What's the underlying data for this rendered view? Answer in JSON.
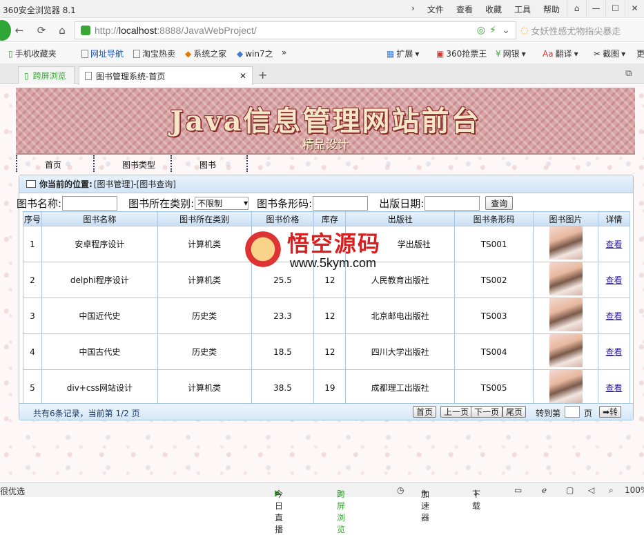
{
  "browser": {
    "title": "360安全浏览器 8.1",
    "menus": [
      "文件",
      "查看",
      "收藏",
      "工具",
      "帮助"
    ],
    "url_host": "http://",
    "url_domain": "localhost",
    "url_rest": ":8888/JavaWebProject/",
    "search_text": "女妖性感尤物指尖暴走",
    "bookmarks": [
      "手机收藏夹",
      "网址导航",
      "淘宝热卖",
      "系统之家",
      "win7之",
      "扩展",
      "360抢票王",
      "网银",
      "翻译",
      "截图",
      "更"
    ],
    "tabs": [
      "跨屏浏览",
      "图书管理系统-首页"
    ]
  },
  "banner": {
    "title": "Java信息管理网站前台",
    "subtitle": "精品设计"
  },
  "nav": [
    "首页",
    "图书类型",
    "图书"
  ],
  "breadcrumb": {
    "label": "你当前的位置:",
    "path": "[图书管理]-[图书查询]"
  },
  "search": {
    "name_label": "图书名称:",
    "category_label": "图书所在类别:",
    "category_value": "不限制",
    "barcode_label": "图书条形码:",
    "date_label": "出版日期:",
    "button": "查询"
  },
  "table": {
    "headers": [
      "序号",
      "图书名称",
      "图书所在类别",
      "图书价格",
      "库存",
      "出版社",
      "图书条形码",
      "图书图片",
      "详情"
    ],
    "rows": [
      {
        "no": "1",
        "name": "安卓程序设计",
        "category": "计算机类",
        "price": "",
        "stock": "",
        "publisher": "学出版社",
        "barcode": "TS001",
        "detail": "查看"
      },
      {
        "no": "2",
        "name": "delphi程序设计",
        "category": "计算机类",
        "price": "25.5",
        "stock": "12",
        "publisher": "人民教育出版社",
        "barcode": "TS002",
        "detail": "查看"
      },
      {
        "no": "3",
        "name": "中国近代史",
        "category": "历史类",
        "price": "23.3",
        "stock": "12",
        "publisher": "北京邮电出版社",
        "barcode": "TS003",
        "detail": "查看"
      },
      {
        "no": "4",
        "name": "中国古代史",
        "category": "历史类",
        "price": "18.5",
        "stock": "12",
        "publisher": "四川大学出版社",
        "barcode": "TS004",
        "detail": "查看"
      },
      {
        "no": "5",
        "name": "div+css网站设计",
        "category": "计算机类",
        "price": "38.5",
        "stock": "19",
        "publisher": "成都理工出版社",
        "barcode": "TS005",
        "detail": "查看"
      }
    ]
  },
  "pager": {
    "info": "共有6条记录，当前第 1/2 页",
    "first": "首页",
    "prev": "上一页",
    "next": "下一页",
    "last": "尾页",
    "goto": "转到第",
    "page_unit": "页",
    "go_button": "➡转"
  },
  "watermark": {
    "text": "悟空源码",
    "url": "www.5kym.com"
  },
  "status": {
    "left": "很优选",
    "items": [
      "今日直播",
      "跨屏浏览",
      "加速器",
      "下载"
    ],
    "zoom": "100%"
  }
}
